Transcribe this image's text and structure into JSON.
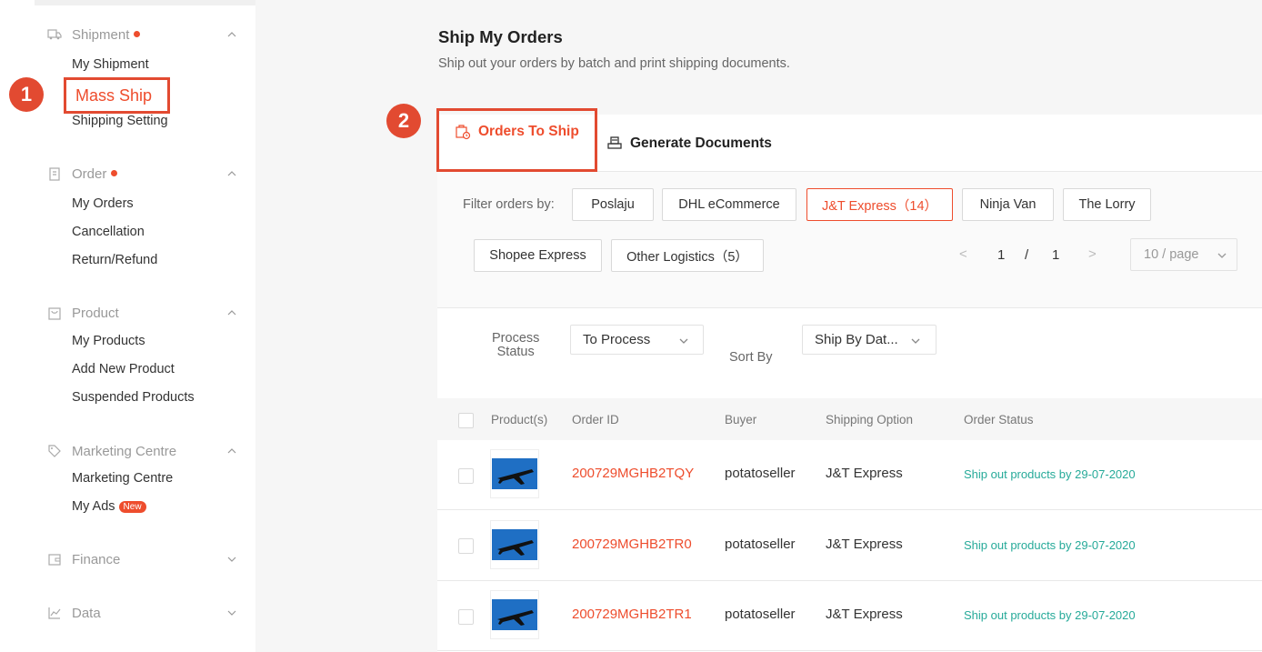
{
  "sidebar": {
    "sections": [
      {
        "title": "Shipment",
        "has_dot": true,
        "expanded": true,
        "icon": "truck-icon",
        "items": [
          "My Shipment",
          "Mass Ship",
          "Shipping Setting"
        ]
      },
      {
        "title": "Order",
        "has_dot": true,
        "expanded": true,
        "icon": "clipboard-icon",
        "items": [
          "My Orders",
          "Cancellation",
          "Return/Refund"
        ]
      },
      {
        "title": "Product",
        "has_dot": false,
        "expanded": true,
        "icon": "bag-icon",
        "items": [
          "My Products",
          "Add New Product",
          "Suspended Products"
        ]
      },
      {
        "title": "Marketing Centre",
        "has_dot": false,
        "expanded": true,
        "icon": "tag-icon",
        "items": [
          "Marketing Centre",
          "My Ads"
        ]
      },
      {
        "title": "Finance",
        "has_dot": false,
        "expanded": false,
        "icon": "wallet-icon",
        "items": []
      },
      {
        "title": "Data",
        "has_dot": false,
        "expanded": false,
        "icon": "chart-icon",
        "items": []
      }
    ],
    "new_badge": "New",
    "active_item": "Mass Ship"
  },
  "annotations": {
    "step1": "1",
    "step2": "2"
  },
  "main": {
    "title": "Ship My Orders",
    "subtitle": "Ship out your orders by batch and print shipping documents."
  },
  "tabs": {
    "orders_to_ship": "Orders To Ship",
    "generate_documents": "Generate Documents"
  },
  "filter": {
    "label": "Filter orders by:",
    "chips": [
      "Poslaju",
      "DHL eCommerce",
      "J&T Express（14）",
      "Ninja Van",
      "The Lorry",
      "Shopee Express",
      "Other Logistics（5）"
    ],
    "selected": "J&T Express（14）"
  },
  "pagination": {
    "current": "1",
    "separator": "/",
    "total": "1",
    "per_page": "10 / page"
  },
  "process": {
    "status_label_line1": "Process",
    "status_label_line2": "Status",
    "status_value": "To Process",
    "sort_label": "Sort By",
    "sort_value": "Ship By Dat..."
  },
  "table": {
    "headers": [
      "Product(s)",
      "Order ID",
      "Buyer",
      "Shipping Option",
      "Order Status"
    ],
    "rows": [
      {
        "order_id": "200729MGHB2TQY",
        "buyer": "potatoseller",
        "shipping": "J&T Express",
        "status": "Ship out products by 29-07-2020"
      },
      {
        "order_id": "200729MGHB2TR0",
        "buyer": "potatoseller",
        "shipping": "J&T Express",
        "status": "Ship out products by 29-07-2020"
      },
      {
        "order_id": "200729MGHB2TR1",
        "buyer": "potatoseller",
        "shipping": "J&T Express",
        "status": "Ship out products by 29-07-2020"
      }
    ]
  },
  "colors": {
    "brand": "#ee4d2d",
    "annotation": "#e24a31",
    "status_green": "#26aa99"
  }
}
